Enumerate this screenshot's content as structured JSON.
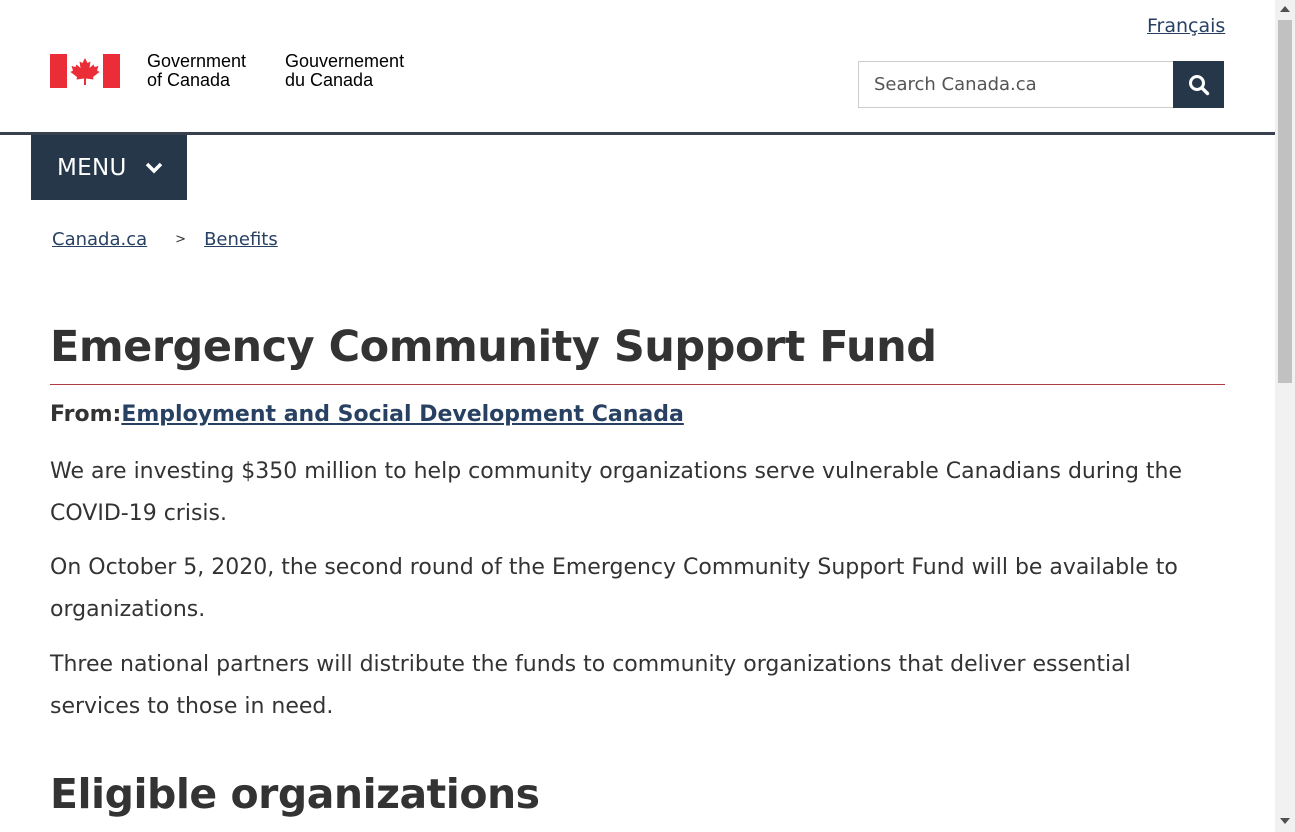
{
  "header": {
    "language_link": "Français",
    "signature": {
      "en_line1": "Government",
      "en_line2": "of Canada",
      "fr_line1": "Gouvernement",
      "fr_line2": "du Canada"
    },
    "search": {
      "placeholder": "Search Canada.ca",
      "button_icon": "search-icon"
    },
    "menu_label": "MENU",
    "menu_icon": "chevron-down-icon"
  },
  "breadcrumb": {
    "items": [
      "Canada.ca",
      "Benefits"
    ],
    "separator": ">"
  },
  "main": {
    "title": "Emergency Community Support Fund",
    "from_label": "From:",
    "from_link": "Employment and Social Development Canada",
    "paragraphs": [
      "We are investing $350 million to help community organizations serve vulnerable Canadians during the COVID-19 crisis.",
      "On October 5, 2020, the second round of the Emergency Community Support Fund will be available to organizations.",
      "Three national partners will distribute the funds to community organizations that deliver essential services to those in need."
    ],
    "section_heading": "Eligible organizations"
  },
  "colors": {
    "flag_red": "#eb2d37",
    "dark_blue": "#26374a",
    "link": "#284162",
    "title_rule": "#af3c43",
    "text": "#333333"
  }
}
